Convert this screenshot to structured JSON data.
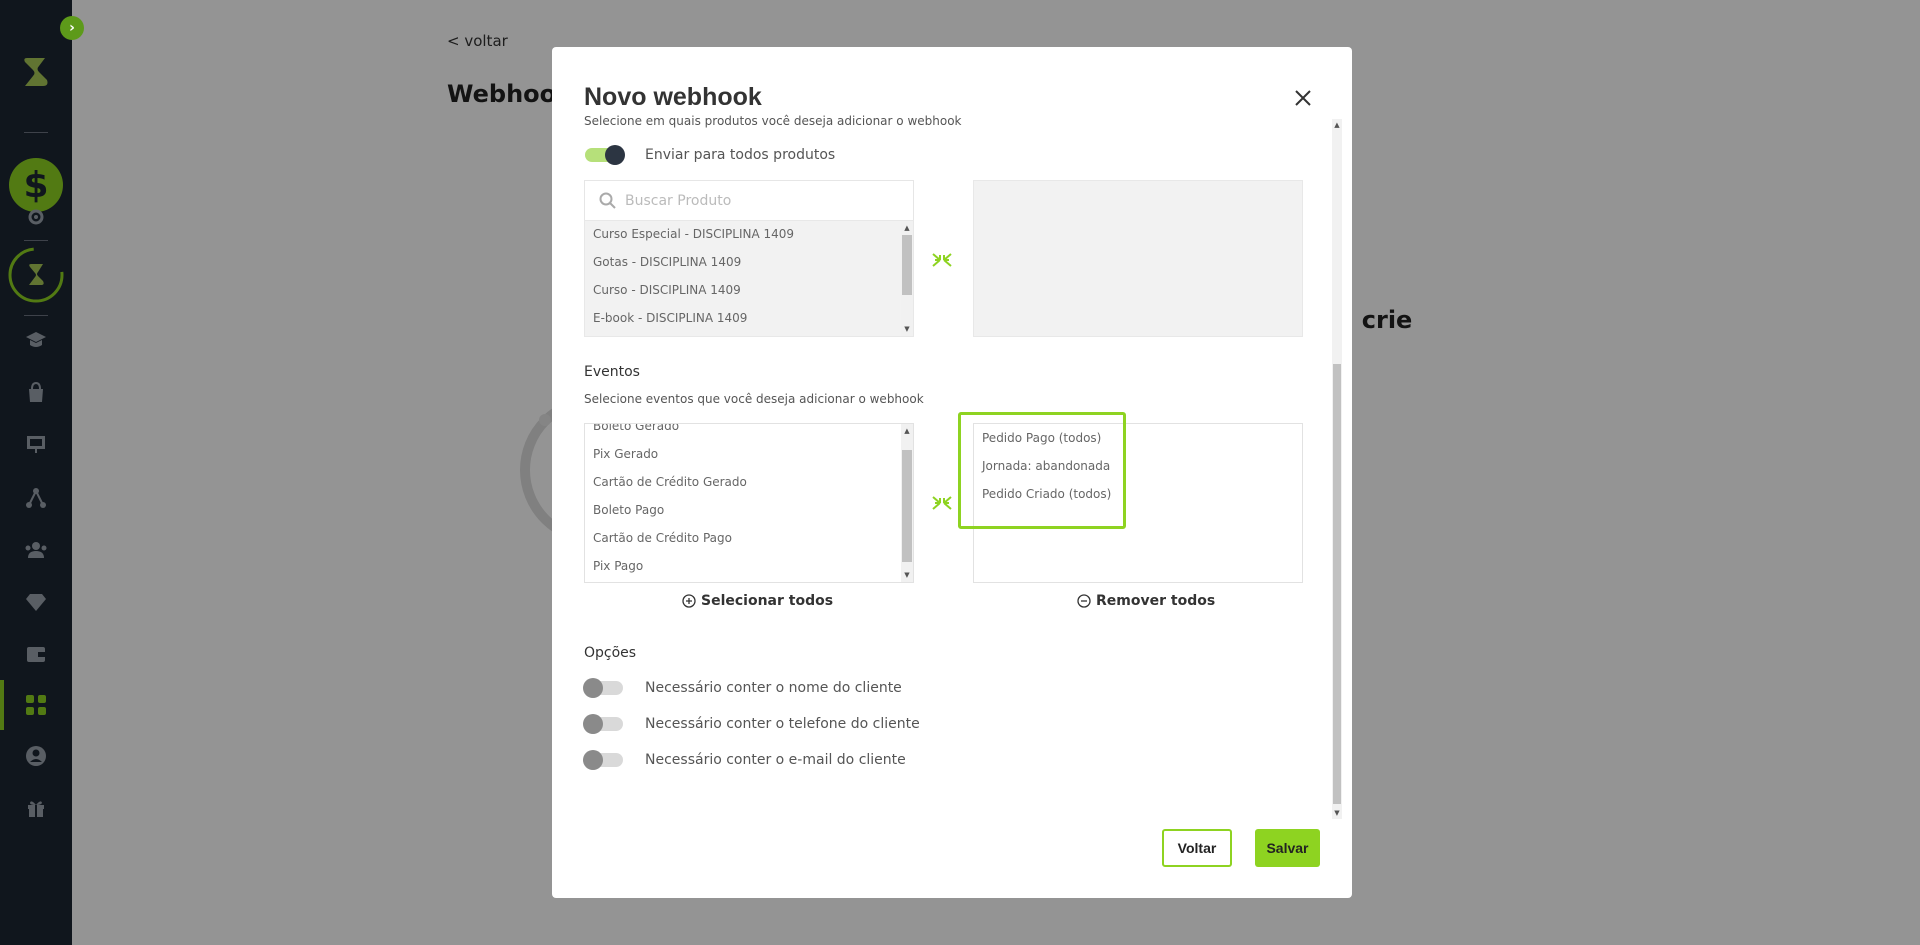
{
  "background": {
    "back_link": "< voltar",
    "page_title_fragment": "Webhook",
    "text_fragment": "s, crie"
  },
  "modal": {
    "title": "Novo webhook",
    "products": {
      "subtitle": "Selecione em quais produtos você deseja adicionar o webhook",
      "toggle_label": "Enviar para todos produtos",
      "search_placeholder": "Buscar Produto",
      "available": [
        "Curso Especial - DISCIPLINA 1409",
        "Gotas - DISCIPLINA 1409",
        "Curso - DISCIPLINA 1409",
        "E-book - DISCIPLINA 1409"
      ]
    },
    "events": {
      "title": "Eventos",
      "subtitle": "Selecione eventos que você deseja adicionar o webhook",
      "available": [
        "Boleto Gerado",
        "Pix Gerado",
        "Cartão de Crédito Gerado",
        "Boleto Pago",
        "Cartão de Crédito Pago",
        "Pix Pago"
      ],
      "selected": [
        "Pedido Pago (todos)",
        "Jornada: abandonada",
        "Pedido Criado (todos)"
      ],
      "select_all": "Selecionar todos",
      "remove_all": "Remover todos"
    },
    "options": {
      "title": "Opções",
      "items": [
        "Necessário conter o nome do cliente",
        "Necessário conter o telefone do cliente",
        "Necessário conter o e-mail do cliente"
      ]
    },
    "buttons": {
      "back": "Voltar",
      "save": "Salvar"
    }
  },
  "colors": {
    "accent": "#8ed321",
    "sidebar": "#1d2633"
  }
}
